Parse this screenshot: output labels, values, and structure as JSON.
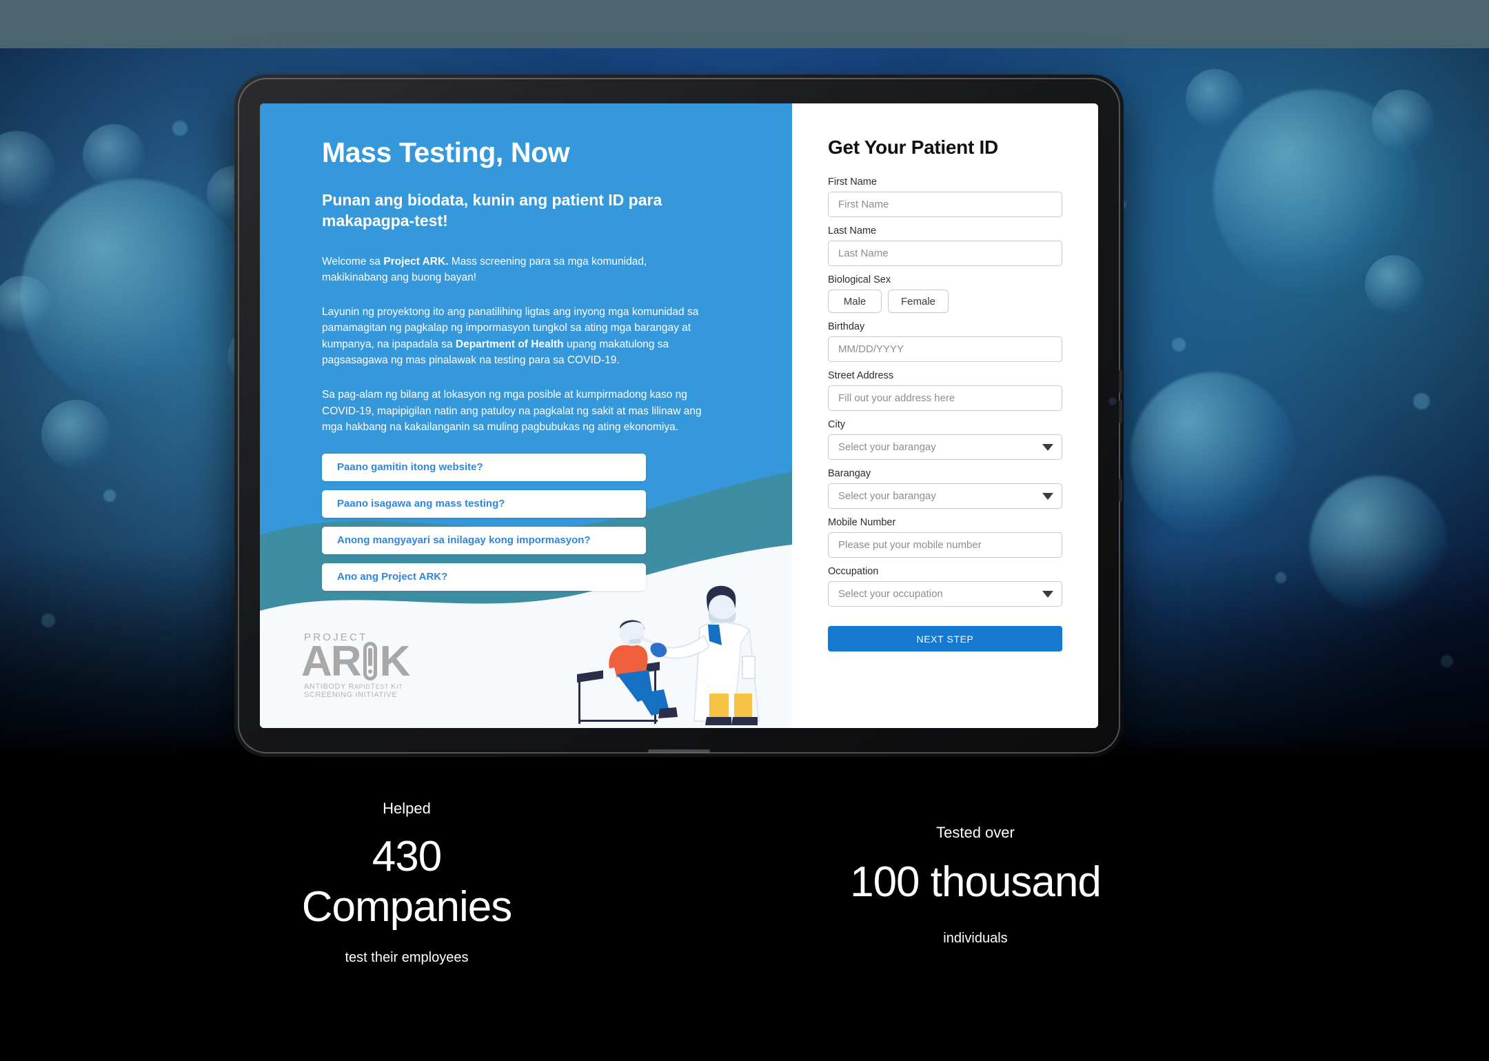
{
  "hero": {
    "title": "Mass Testing, Now",
    "subtitle": "Punan ang biodata, kunin ang patient ID para makapagpa-test!",
    "p1_pre": "Welcome sa ",
    "p1_bold": "Project ARK.",
    "p1_post": " Mass screening para sa mga komunidad, makikinabang ang buong bayan!",
    "p2_pre": "Layunin ng proyektong ito ang panatilihing ligtas ang inyong mga komunidad sa pamamagitan ng pagkalap ng impormasyon tungkol sa ating mga barangay at kumpanya, na ipapadala sa ",
    "p2_bold": "Department of Health",
    "p2_post": " upang makatulong sa pagsasagawa ng mas pinalawak na testing para sa COVID-19.",
    "p3": "Sa pag-alam ng bilang at lokasyon ng mga posible at kumpirmadong kaso ng COVID-19, mapipigilan natin ang patuloy na pagkalat ng sakit at mas lilinaw ang mga hakbang na kakailanganin sa muling pagbubukas ng ating ekonomiya."
  },
  "faq": {
    "items": [
      {
        "label": "Paano gamitin itong website?"
      },
      {
        "label": "Paano isagawa ang mass testing?"
      },
      {
        "label": "Anong mangyayari sa inilagay kong impormasyon?"
      },
      {
        "label": "Ano ang Project ARK?"
      }
    ]
  },
  "logo": {
    "line1": "PROJECT",
    "ar": "AR",
    "k": "K",
    "tagline1_a": "ANTIBODY ",
    "tagline1_b": "R",
    "tagline1_c": "APID",
    "tagline1_d": "T",
    "tagline1_e": "EST ",
    "tagline1_f": "K",
    "tagline1_g": "IT",
    "tagline2": "SCREENING INITIATIVE"
  },
  "form": {
    "title": "Get Your Patient ID",
    "first_name": {
      "label": "First Name",
      "placeholder": "First Name",
      "value": ""
    },
    "last_name": {
      "label": "Last Name",
      "placeholder": "Last Name",
      "value": ""
    },
    "biological_sex": {
      "label": "Biological Sex",
      "options": [
        {
          "label": "Male"
        },
        {
          "label": "Female"
        }
      ]
    },
    "birthday": {
      "label": "Birthday",
      "placeholder": "MM/DD/YYYY",
      "value": ""
    },
    "street_address": {
      "label": "Street Address",
      "placeholder": "Fill out your address here",
      "value": ""
    },
    "city": {
      "label": "City",
      "selected": "Select your barangay"
    },
    "barangay": {
      "label": "Barangay",
      "selected": "Select your barangay"
    },
    "mobile_number": {
      "label": "Mobile Number",
      "placeholder": "Please put your mobile number",
      "value": ""
    },
    "occupation": {
      "label": "Occupation",
      "selected": "Select your occupation"
    },
    "next_button": "NEXT STEP"
  },
  "stats": [
    {
      "caption": "Helped",
      "number": "430",
      "unit": "Companies",
      "footer": "test their employees"
    },
    {
      "caption": "Tested over",
      "number": "100 thousand",
      "unit": "",
      "footer": "individuals"
    }
  ],
  "colors": {
    "brand_blue": "#3498db",
    "teal": "#3d8ea3",
    "button_blue": "#1479cf",
    "link_blue": "#2e86de",
    "strip_grey": "#4a6570"
  }
}
